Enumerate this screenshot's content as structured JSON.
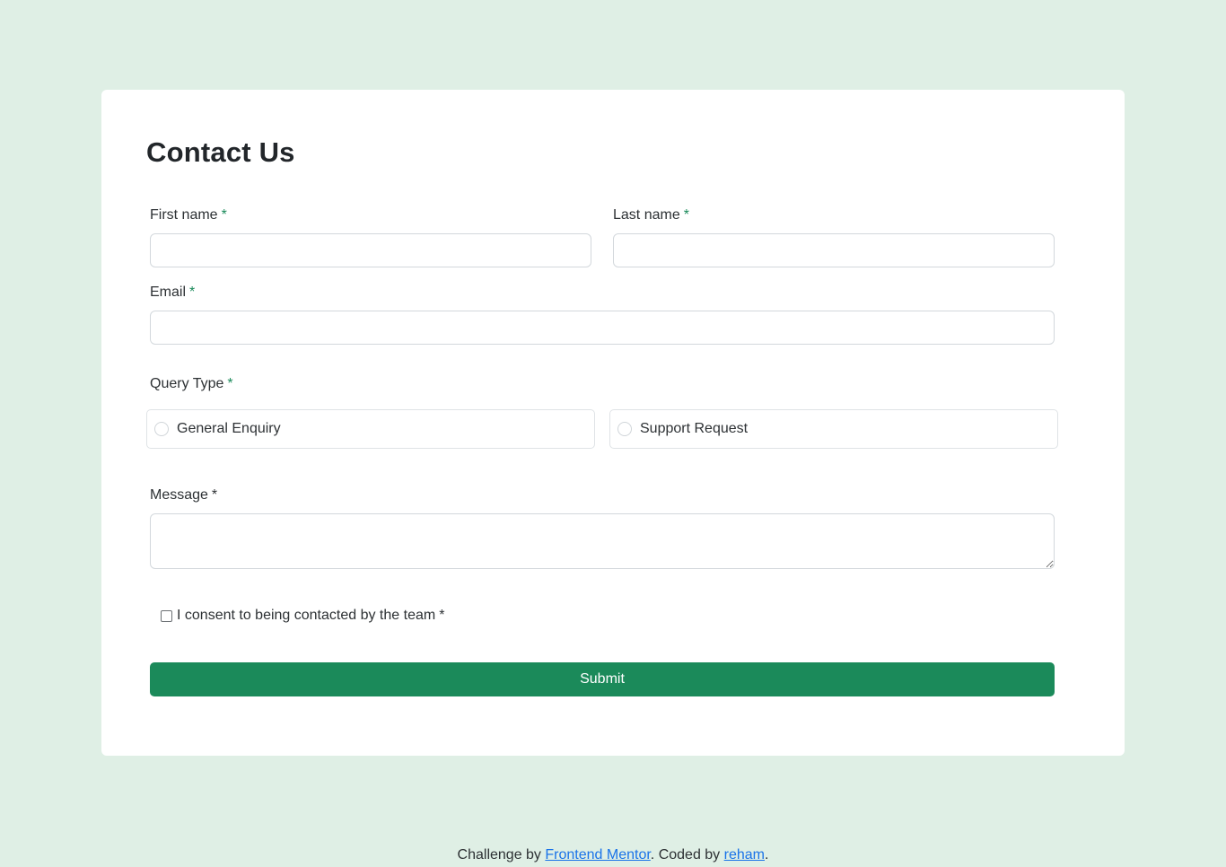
{
  "form": {
    "title": "Contact Us",
    "first_name": {
      "label": "First name",
      "required_mark": "*",
      "value": "",
      "placeholder": ""
    },
    "last_name": {
      "label": "Last name",
      "required_mark": "*",
      "value": "",
      "placeholder": ""
    },
    "email": {
      "label": "Email",
      "required_mark": "*",
      "value": "",
      "placeholder": ""
    },
    "query_type": {
      "label": "Query Type",
      "required_mark": "*",
      "options": [
        {
          "label": "General Enquiry",
          "selected": false
        },
        {
          "label": "Support Request",
          "selected": false
        }
      ]
    },
    "message": {
      "label": "Message",
      "required_mark": "*",
      "value": ""
    },
    "consent": {
      "label": "I consent to being contacted by the team",
      "required_mark": "*",
      "checked": false
    },
    "submit_label": "Submit"
  },
  "footer": {
    "prefix": "Challenge by",
    "link1": "Frontend Mentor",
    "middle": ". Coded by",
    "link2": "reham",
    "suffix": "."
  },
  "colors": {
    "background": "#dfefe5",
    "card": "#ffffff",
    "accent": "#1b8a5a",
    "link": "#1a73e8"
  }
}
